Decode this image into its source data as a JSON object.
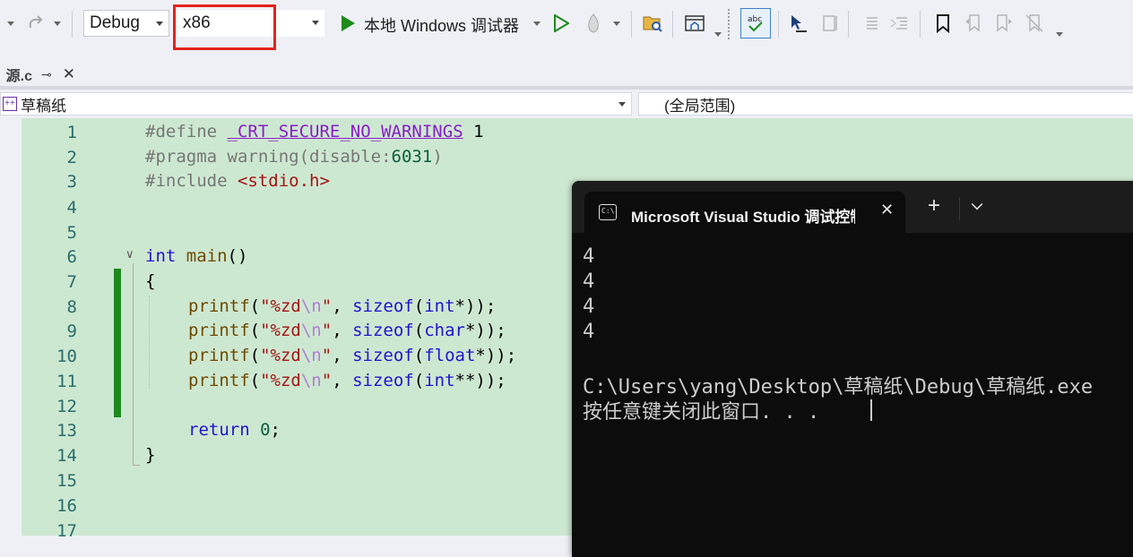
{
  "toolbar": {
    "config": "Debug",
    "platform": "x86",
    "run_label": "本地 Windows 调试器"
  },
  "tab": {
    "title": "源.c"
  },
  "navbar": {
    "project": "草稿纸",
    "scope": "(全局范围)"
  },
  "editor": {
    "line_numbers": [
      "1",
      "2",
      "3",
      "4",
      "5",
      "6",
      "7",
      "8",
      "9",
      "10",
      "11",
      "12",
      "13",
      "14",
      "15",
      "16",
      "17"
    ]
  },
  "code": {
    "l1_pp": "#define",
    "l1_macro": "_CRT_SECURE_NO_WARNINGS",
    "l1_val": "1",
    "l2_pp": "#pragma warning(disable:",
    "l2_num": "6031",
    "l2_close": ")",
    "l3_pp": "#include",
    "l3_inc": "<stdio.h>",
    "l6_type": "int",
    "l6_name": "main",
    "l6_paren": "()",
    "l7": "{",
    "printf": "printf",
    "fmt_a": "\"%zd",
    "fmt_esc": "\\n",
    "fmt_b": "\"",
    "comma": ", ",
    "sizeof": "sizeof",
    "l8_type": "int",
    "l8_rest": "*));",
    "l9_type": "char",
    "l9_rest": "*));",
    "l10_type": "float",
    "l10_rest": "*));",
    "l11_type": "int",
    "l11_rest": "**));",
    "open": "(",
    "l13_kw": "return",
    "l13_num": "0",
    "l13_semi": ";",
    "l14": "}"
  },
  "terminal": {
    "tab_title": "Microsoft Visual Studio 调试控制台",
    "output": [
      "4",
      "4",
      "4",
      "4",
      "",
      "C:\\Users\\yang\\Desktop\\草稿纸\\Debug\\草稿纸.exe",
      "按任意键关闭此窗口. . ."
    ]
  },
  "colors": {
    "highlight": "#e3241d",
    "editor_bg": "#cde8d1",
    "change_bar": "#1e8a1e"
  }
}
